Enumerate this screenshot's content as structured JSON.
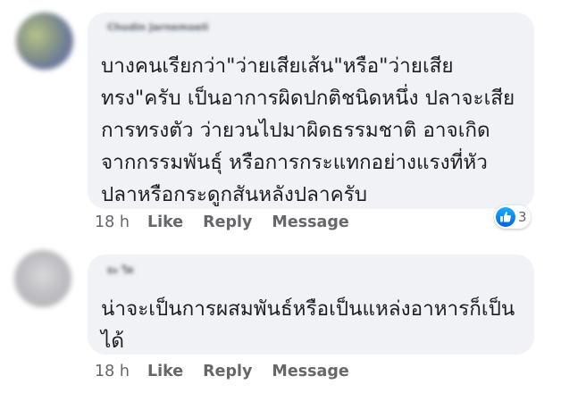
{
  "comments": [
    {
      "author": "Chudin Jarnemoeli",
      "lines": [
        "บางคนเรียกว่า\"ว่ายเสียเส้น\"หรือ\"ว่ายเสีย",
        "ทรง\"ครับ เป็นอาการผิดปกติชนิดหนึ่ง ปลาจะเสีย",
        "การทรงตัว ว่ายวนไปมาผิดธรรมชาติ อาจเกิด",
        "จากกรรมพันธุ์ หรือการกระแทกอย่างแรงที่หัว",
        "ปลาหรือกระดูกสันหลังปลาครับ"
      ],
      "time": "18 h",
      "actions": {
        "like": "Like",
        "reply": "Reply",
        "message": "Message"
      },
      "reaction_count": "3"
    },
    {
      "author": "ยะ วิต",
      "lines": [
        "น่าจะเป็นการผสมพันธ์หรือเป็นแหล่งอาหารก็เป็น",
        "ได้"
      ],
      "time": "18 h",
      "actions": {
        "like": "Like",
        "reply": "Reply",
        "message": "Message"
      }
    }
  ],
  "colors": {
    "bubble": "#f0f2f5",
    "text": "#1c1e21",
    "meta": "#65676b",
    "like_blue": "#1877f2"
  },
  "icons": {
    "reaction": "thumbs-up-icon"
  }
}
